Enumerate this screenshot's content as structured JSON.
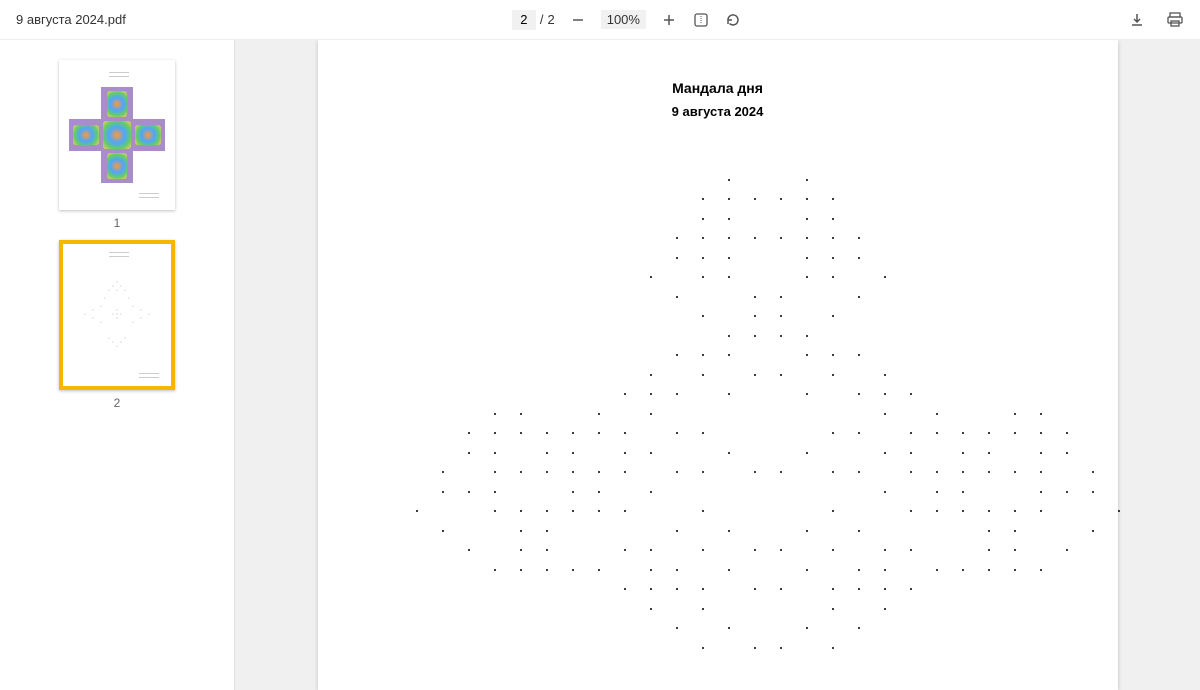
{
  "toolbar": {
    "filename": "9 августа 2024.pdf",
    "current_page": "2",
    "page_sep": "/",
    "total_pages": "2",
    "zoom": "100%"
  },
  "sidebar": {
    "thumbs": [
      {
        "label": "1",
        "active": false
      },
      {
        "label": "2",
        "active": true
      }
    ]
  },
  "document": {
    "title": "Мандала дня",
    "subtitle": "9 августа 2024"
  },
  "mandala_dots": [
    [
      20,
      1
    ],
    [
      26,
      1
    ],
    [
      18,
      2
    ],
    [
      20,
      2
    ],
    [
      22,
      2
    ],
    [
      24,
      2
    ],
    [
      26,
      2
    ],
    [
      28,
      2
    ],
    [
      18,
      3
    ],
    [
      20,
      3
    ],
    [
      26,
      3
    ],
    [
      28,
      3
    ],
    [
      16,
      4
    ],
    [
      18,
      4
    ],
    [
      20,
      4
    ],
    [
      22,
      4
    ],
    [
      24,
      4
    ],
    [
      26,
      4
    ],
    [
      28,
      4
    ],
    [
      30,
      4
    ],
    [
      16,
      5
    ],
    [
      18,
      5
    ],
    [
      20,
      5
    ],
    [
      26,
      5
    ],
    [
      28,
      5
    ],
    [
      30,
      5
    ],
    [
      14,
      6
    ],
    [
      18,
      6
    ],
    [
      20,
      6
    ],
    [
      26,
      6
    ],
    [
      28,
      6
    ],
    [
      32,
      6
    ],
    [
      16,
      7
    ],
    [
      22,
      7
    ],
    [
      24,
      7
    ],
    [
      30,
      7
    ],
    [
      18,
      8
    ],
    [
      22,
      8
    ],
    [
      24,
      8
    ],
    [
      28,
      8
    ],
    [
      20,
      9
    ],
    [
      22,
      9
    ],
    [
      24,
      9
    ],
    [
      26,
      9
    ],
    [
      16,
      10
    ],
    [
      18,
      10
    ],
    [
      20,
      10
    ],
    [
      26,
      10
    ],
    [
      28,
      10
    ],
    [
      30,
      10
    ],
    [
      14,
      11
    ],
    [
      18,
      11
    ],
    [
      22,
      11
    ],
    [
      24,
      11
    ],
    [
      28,
      11
    ],
    [
      32,
      11
    ],
    [
      12,
      12
    ],
    [
      14,
      12
    ],
    [
      16,
      12
    ],
    [
      20,
      12
    ],
    [
      26,
      12
    ],
    [
      30,
      12
    ],
    [
      32,
      12
    ],
    [
      34,
      12
    ],
    [
      2,
      13
    ],
    [
      4,
      13
    ],
    [
      10,
      13
    ],
    [
      14,
      13
    ],
    [
      32,
      13
    ],
    [
      36,
      13
    ],
    [
      42,
      13
    ],
    [
      44,
      13
    ],
    [
      0,
      14
    ],
    [
      2,
      14
    ],
    [
      4,
      14
    ],
    [
      6,
      14
    ],
    [
      8,
      14
    ],
    [
      10,
      14
    ],
    [
      12,
      14
    ],
    [
      16,
      14
    ],
    [
      18,
      14
    ],
    [
      28,
      14
    ],
    [
      30,
      14
    ],
    [
      34,
      14
    ],
    [
      36,
      14
    ],
    [
      38,
      14
    ],
    [
      40,
      14
    ],
    [
      42,
      14
    ],
    [
      44,
      14
    ],
    [
      46,
      14
    ],
    [
      0,
      15
    ],
    [
      2,
      15
    ],
    [
      6,
      15
    ],
    [
      8,
      15
    ],
    [
      12,
      15
    ],
    [
      14,
      15
    ],
    [
      20,
      15
    ],
    [
      26,
      15
    ],
    [
      32,
      15
    ],
    [
      34,
      15
    ],
    [
      38,
      15
    ],
    [
      40,
      15
    ],
    [
      44,
      15
    ],
    [
      46,
      15
    ],
    [
      -2,
      16
    ],
    [
      2,
      16
    ],
    [
      4,
      16
    ],
    [
      6,
      16
    ],
    [
      8,
      16
    ],
    [
      10,
      16
    ],
    [
      12,
      16
    ],
    [
      16,
      16
    ],
    [
      18,
      16
    ],
    [
      22,
      16
    ],
    [
      24,
      16
    ],
    [
      28,
      16
    ],
    [
      30,
      16
    ],
    [
      34,
      16
    ],
    [
      36,
      16
    ],
    [
      38,
      16
    ],
    [
      40,
      16
    ],
    [
      42,
      16
    ],
    [
      44,
      16
    ],
    [
      48,
      16
    ],
    [
      -2,
      17
    ],
    [
      0,
      17
    ],
    [
      2,
      17
    ],
    [
      8,
      17
    ],
    [
      10,
      17
    ],
    [
      14,
      17
    ],
    [
      32,
      17
    ],
    [
      36,
      17
    ],
    [
      38,
      17
    ],
    [
      44,
      17
    ],
    [
      46,
      17
    ],
    [
      48,
      17
    ],
    [
      -4,
      18
    ],
    [
      2,
      18
    ],
    [
      4,
      18
    ],
    [
      6,
      18
    ],
    [
      8,
      18
    ],
    [
      10,
      18
    ],
    [
      12,
      18
    ],
    [
      18,
      18
    ],
    [
      28,
      18
    ],
    [
      34,
      18
    ],
    [
      36,
      18
    ],
    [
      38,
      18
    ],
    [
      40,
      18
    ],
    [
      42,
      18
    ],
    [
      44,
      18
    ],
    [
      50,
      18
    ],
    [
      -2,
      19
    ],
    [
      4,
      19
    ],
    [
      6,
      19
    ],
    [
      16,
      19
    ],
    [
      20,
      19
    ],
    [
      26,
      19
    ],
    [
      30,
      19
    ],
    [
      40,
      19
    ],
    [
      42,
      19
    ],
    [
      48,
      19
    ],
    [
      0,
      20
    ],
    [
      4,
      20
    ],
    [
      6,
      20
    ],
    [
      12,
      20
    ],
    [
      14,
      20
    ],
    [
      18,
      20
    ],
    [
      22,
      20
    ],
    [
      24,
      20
    ],
    [
      28,
      20
    ],
    [
      32,
      20
    ],
    [
      34,
      20
    ],
    [
      40,
      20
    ],
    [
      42,
      20
    ],
    [
      46,
      20
    ],
    [
      2,
      21
    ],
    [
      4,
      21
    ],
    [
      6,
      21
    ],
    [
      8,
      21
    ],
    [
      10,
      21
    ],
    [
      14,
      21
    ],
    [
      16,
      21
    ],
    [
      20,
      21
    ],
    [
      26,
      21
    ],
    [
      30,
      21
    ],
    [
      32,
      21
    ],
    [
      36,
      21
    ],
    [
      38,
      21
    ],
    [
      40,
      21
    ],
    [
      42,
      21
    ],
    [
      44,
      21
    ],
    [
      12,
      22
    ],
    [
      14,
      22
    ],
    [
      16,
      22
    ],
    [
      18,
      22
    ],
    [
      22,
      22
    ],
    [
      24,
      22
    ],
    [
      28,
      22
    ],
    [
      30,
      22
    ],
    [
      32,
      22
    ],
    [
      34,
      22
    ],
    [
      14,
      23
    ],
    [
      18,
      23
    ],
    [
      28,
      23
    ],
    [
      32,
      23
    ],
    [
      16,
      24
    ],
    [
      20,
      24
    ],
    [
      26,
      24
    ],
    [
      30,
      24
    ],
    [
      18,
      25
    ],
    [
      22,
      25
    ],
    [
      24,
      25
    ],
    [
      28,
      25
    ]
  ]
}
